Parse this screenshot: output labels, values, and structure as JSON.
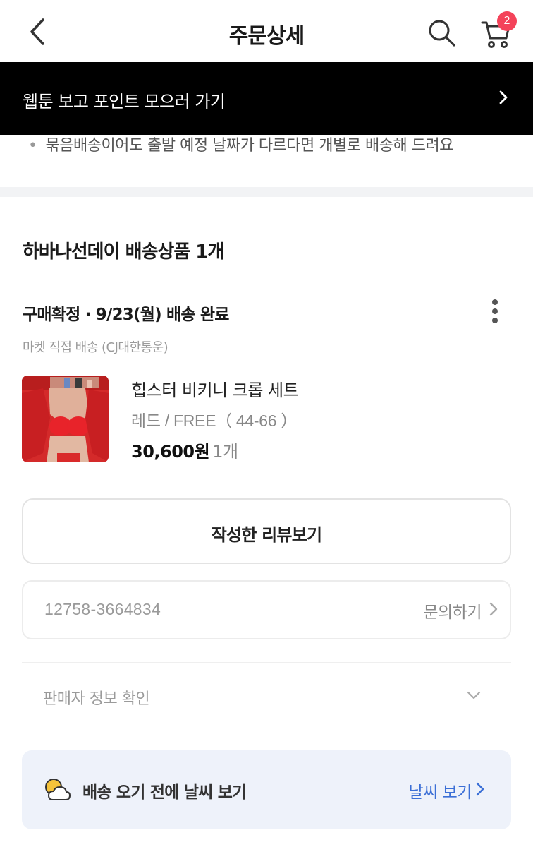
{
  "header": {
    "title": "주문상세",
    "cart_count": "2"
  },
  "banner": {
    "text": "웹툰 보고 포인트 모으러 가기"
  },
  "notice": {
    "bullet": "•",
    "text": "묶음배송이어도 출발 예정 날짜가 다르다면 개별로 배송해 드려요"
  },
  "shipment": {
    "title": "하바나선데이 배송상품 1개",
    "status": "구매확정 · 9/23(월) 배송 완료",
    "method": "마켓 직접 배송 (CJ대한통운)"
  },
  "product": {
    "name": "힙스터 비키니 크롭 세트",
    "option": "레드 / FREE（ 44-66 ）",
    "price": "30,600원",
    "quantity": "1개"
  },
  "review_button": {
    "label": "작성한 리뷰보기"
  },
  "order": {
    "number": "12758-3664834",
    "inquiry_label": "문의하기"
  },
  "seller": {
    "label": "판매자 정보 확인"
  },
  "weather": {
    "text": "배송 오기 전에 날씨 보기",
    "link_label": "날씨 보기"
  },
  "icons": {
    "back": "back-arrow-icon",
    "search": "search-icon",
    "cart": "cart-icon",
    "banner_arrow": "chevron-right-icon",
    "more": "more-vertical-icon",
    "inquiry_arrow": "chevron-right-icon",
    "seller_toggle": "chevron-down-icon",
    "weather": "weather-icon"
  },
  "colors": {
    "badge": "#f4435a",
    "banner_bg": "#000000",
    "weather_card_bg": "#eef2fa",
    "link_blue": "#3b6fd6"
  }
}
